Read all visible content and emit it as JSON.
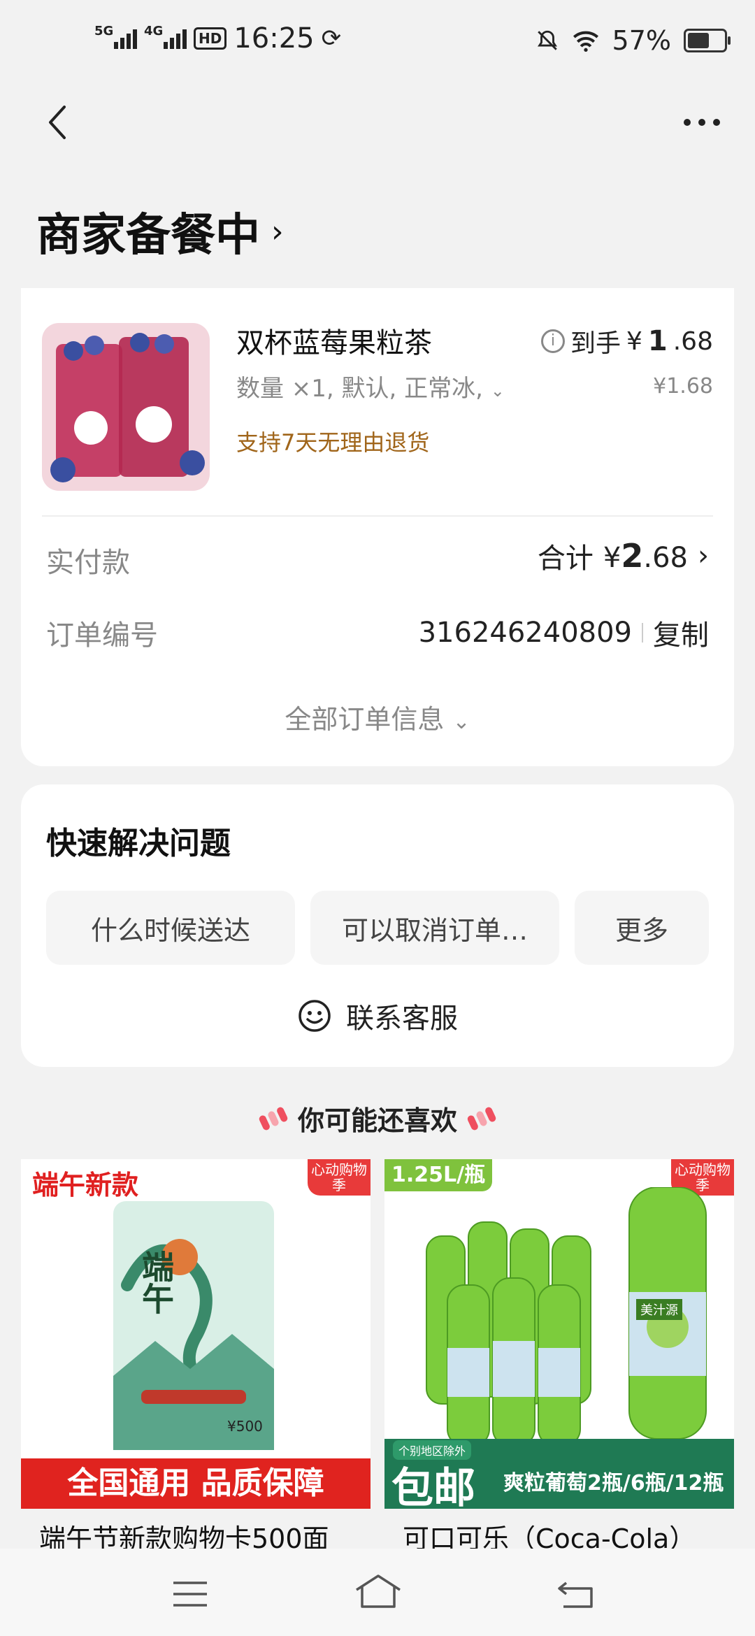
{
  "status_bar": {
    "network1": "5G",
    "network2": "4G",
    "hd": "HD",
    "time": "16:25",
    "battery": "57%"
  },
  "header": {
    "title": "商家备餐中",
    "title_chevron": "›"
  },
  "order": {
    "product_name": "双杯蓝莓果粒茶",
    "spec": "数量 ×1, 默认, 正常冰,",
    "return_policy": "支持7天无理由退货",
    "price_label": "到手",
    "price_currency": "¥",
    "price_int": "1",
    "price_dec": ".68",
    "original_price": "¥1.68",
    "paid_label": "实付款",
    "total_label": "合计",
    "total_currency": "¥",
    "total_int": "2",
    "total_dec": ".68",
    "order_no_label": "订单编号",
    "order_no": "316246240809",
    "copy_label": "复制",
    "all_info_label": "全部订单信息"
  },
  "quick": {
    "title": "快速解决问题",
    "chips": [
      "什么时候送达",
      "可以取消订单…",
      "更多"
    ],
    "contact": "联系客服"
  },
  "recommend": {
    "title": "你可能还喜欢",
    "products": [
      {
        "title": "端午节新款购物卡500面",
        "tag": "端午新款",
        "badge": "心动购物季",
        "banner": "全国通用 品质保障",
        "card_title": "端午",
        "card_value": "¥500"
      },
      {
        "title": "可口可乐（Coca-Cola）",
        "tag": "1.25L/瓶",
        "badge": "心动购物季",
        "banner_small": "个别地区除外",
        "banner_big": "包邮",
        "banner_right": "爽粒葡萄2瓶/6瓶/12瓶",
        "bottle_brand": "美汁源"
      }
    ]
  },
  "colors": {
    "accent_brown": "#a0651a",
    "red": "#e02020",
    "green": "#6cc04a"
  }
}
